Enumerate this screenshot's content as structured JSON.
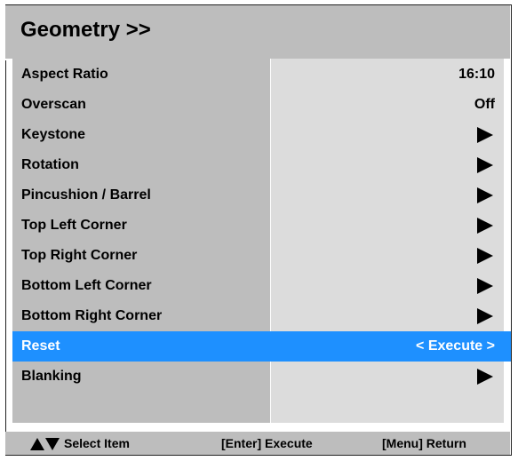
{
  "header": {
    "title": "Geometry >>"
  },
  "menu": {
    "items": [
      {
        "label": "Aspect Ratio",
        "value": "16:10"
      },
      {
        "label": "Overscan",
        "value": "Off"
      },
      {
        "label": "Keystone",
        "value": ""
      },
      {
        "label": "Rotation",
        "value": ""
      },
      {
        "label": "Pincushion / Barrel",
        "value": ""
      },
      {
        "label": "Top Left Corner",
        "value": ""
      },
      {
        "label": "Top Right Corner",
        "value": ""
      },
      {
        "label": "Bottom Left Corner",
        "value": ""
      },
      {
        "label": "Bottom Right Corner",
        "value": ""
      },
      {
        "label": "Reset",
        "value": "< Execute >"
      },
      {
        "label": "Blanking",
        "value": ""
      }
    ],
    "selected_index": 9,
    "selected_color": "#1e90ff",
    "submenu_icon": "right-triangle-icon"
  },
  "footer": {
    "select_label": "Select Item",
    "execute_label": "[Enter] Execute",
    "return_label": "[Menu] Return",
    "nav_icons": [
      "up-triangle-icon",
      "down-triangle-icon"
    ]
  }
}
